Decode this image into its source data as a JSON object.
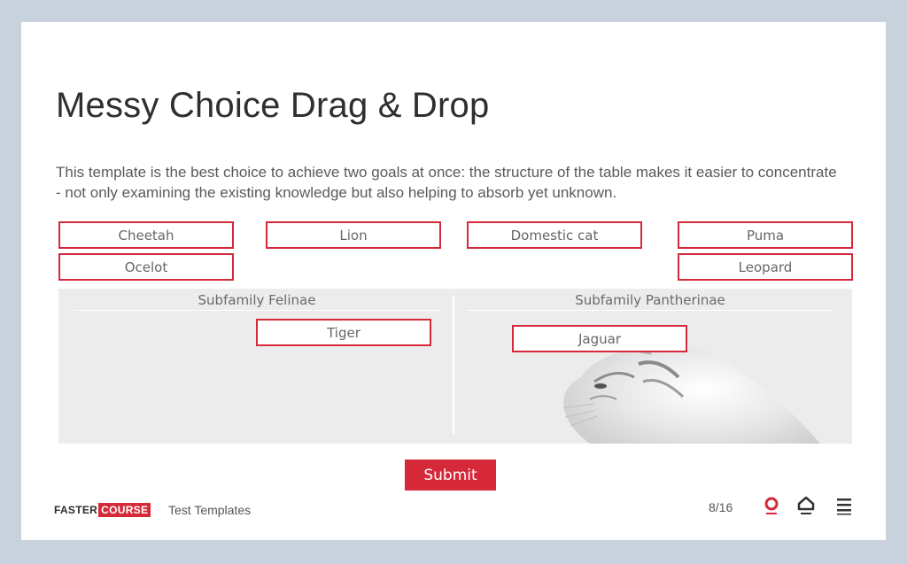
{
  "slide": {
    "title": "Messy Choice Drag & Drop",
    "description": "This template is the best choice to achieve two goals at once: the structure of the table makes it easier to concentrate - not only examining the existing knowledge but also helping to absorb yet unknown."
  },
  "draggables": {
    "cheetah": "Cheetah",
    "lion": "Lion",
    "domestic_cat": "Domestic cat",
    "puma": "Puma",
    "ocelot": "Ocelot",
    "leopard": "Leopard",
    "tiger": "Tiger",
    "jaguar": "Jaguar"
  },
  "table": {
    "columns": [
      "Subfamily Felinae",
      "Subfamily Pantherinae"
    ]
  },
  "submit_label": "Submit",
  "footer": {
    "logo_part1": "FASTER",
    "logo_part2": "COURSE",
    "course_name": "Test Templates",
    "page_indicator": "8/16"
  },
  "colors": {
    "accent": "#d5293a",
    "background": "#c8d2dd"
  },
  "icons": {
    "help": "lifebuoy-icon",
    "home": "home-icon",
    "menu": "hamburger-menu-icon"
  }
}
